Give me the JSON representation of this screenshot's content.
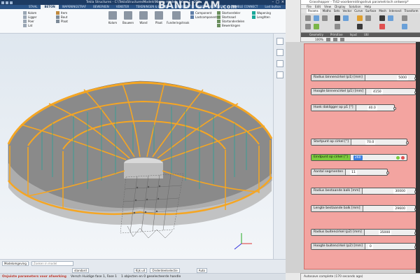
{
  "tekla": {
    "title": "Tekla Structures - C:\\TeklaStructuresModels\\Nieuw model - [View 1 - 3D]",
    "tabs": [
      "STAAL",
      "BETON",
      "WAPENINGSTRAF",
      "BEWERKEN",
      "VENSTER",
      "TEKENINGEN & LIJSTEN",
      "BEHEREN",
      "ANALYSIS & DESIGN",
      "TRIMBLE CONNECT",
      "Lost button"
    ],
    "active_tab": "BETON",
    "ribbon": {
      "col1": [
        "Kolom",
        "Ligger",
        "Poer",
        "Lat"
      ],
      "col2": [
        "Item",
        "Bout",
        "Plaat"
      ],
      "big": [
        "Kolom",
        "Bouwen",
        "Wand",
        "Plaat",
        "Funderingstrook"
      ],
      "col3": [
        "Component",
        "Lastcomponent"
      ],
      "col4": [
        "Stortverdeler",
        "Stortnaad"
      ],
      "col5": [
        "Stortonderdelen",
        "Bewerkingen"
      ],
      "right": [
        "Wapening",
        "Lenghten"
      ]
    },
    "bottom_bar": {
      "model_status_label": "Modelomgeving",
      "filter_placeholder": "Zoeken in model",
      "snap_label": "standard",
      "select_label": "Kijk uit",
      "dropdown_label": "Onderdeelselectie",
      "auto_label": "Auto"
    },
    "status": {
      "error": "Onjuiste parameters voor afwerking",
      "message": "Versch Huidige fase 1, Fase 1",
      "selection": "1 objecten en 0 geselecteerde handle"
    },
    "watermark": {
      "part1": "BANDI",
      "part2": "CAM",
      "suffix": ".com"
    }
  },
  "grasshopper": {
    "title": "Grasshopper - TI42-voorbereidingsdruk parametrisch ontwerp*",
    "menu": [
      "File",
      "Edit",
      "View",
      "Display",
      "Solution",
      "Help"
    ],
    "tabs": [
      "Params",
      "Maths",
      "Sets",
      "Vector",
      "Curve",
      "Surface",
      "Mesh",
      "Intersect",
      "Transform"
    ],
    "categories": [
      "Geometry",
      "Primitive",
      "Input",
      "Util"
    ],
    "zoom": "100%",
    "sliders": [
      {
        "label": "Radius binnencirkel (p1) [mm]",
        "value": "5000"
      },
      {
        "label": "Hoogte binnencirkel (p1) [mm]",
        "value": "4150"
      },
      {
        "label": "Hoek dakligger op p1 [°]",
        "value": "40.0"
      },
      {
        "label": "Startpunt op cirkel [°]",
        "value": "70.0"
      },
      {
        "label": "Eindpunt op cirkel [°]",
        "value": "260"
      },
      {
        "label": "Aantal segmenten",
        "value": "11"
      },
      {
        "label": "Radius bestaande balk [mm]",
        "value": "30000"
      },
      {
        "label": "Lengte bestaande balk [mm]",
        "value": "29600"
      },
      {
        "label": "Radius buitencirkel (p2) [mm]",
        "value": "35000"
      },
      {
        "label": "Hoogte buitencirkel (p2) [mm]",
        "value": "0"
      }
    ],
    "status": "Autosave complete (170 seconds ago)",
    "accent": "#f3a4a0"
  },
  "colors": {
    "tekla_header": "#1d3b63",
    "beam": "#f5a623",
    "rebar": "#1aa89a",
    "slab": "#8a8a8a"
  }
}
